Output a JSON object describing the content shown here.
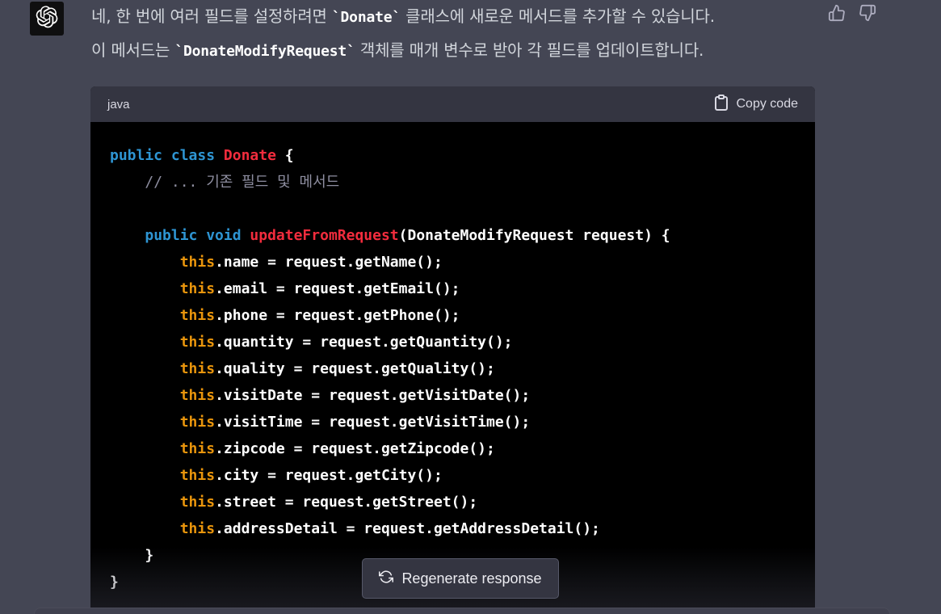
{
  "assistant": {
    "avatar_icon": "openai-logo-icon"
  },
  "message": {
    "line1_before": "네, 한 번에 여러 필드를 설정하려면 ",
    "line1_code": "`Donate`",
    "line1_after": " 클래스에 새로운 메서드를 추가할 수 있습니다.",
    "line2_before": "이 메서드는 ",
    "line2_code": "`DonateModifyRequest`",
    "line2_after": " 객체를 매개 변수로 받아 각 필드를 업데이트합니다."
  },
  "feedback": {
    "thumbs_up_icon": "thumbs-up-icon",
    "thumbs_down_icon": "thumbs-down-icon"
  },
  "code_block": {
    "language": "java",
    "copy_label": "Copy code",
    "copy_icon": "clipboard-icon",
    "lines": {
      "l1": {
        "kw": "public class ",
        "cls": "Donate",
        "rest": " {"
      },
      "l2": {
        "indent": "    ",
        "comment": "// ... 기존 필드 및 메서드"
      },
      "l4": {
        "indent": "    ",
        "kw": "public void ",
        "fn": "updateFromRequest",
        "rest": "(DonateModifyRequest request) {"
      },
      "fields": [
        {
          "this": "this",
          "rest": ".name = request.getName();"
        },
        {
          "this": "this",
          "rest": ".email = request.getEmail();"
        },
        {
          "this": "this",
          "rest": ".phone = request.getPhone();"
        },
        {
          "this": "this",
          "rest": ".quantity = request.getQuantity();"
        },
        {
          "this": "this",
          "rest": ".quality = request.getQuality();"
        },
        {
          "this": "this",
          "rest": ".visitDate = request.getVisitDate();"
        },
        {
          "this": "this",
          "rest": ".visitTime = request.getVisitTime();"
        },
        {
          "this": "this",
          "rest": ".zipcode = request.getZipcode();"
        },
        {
          "this": "this",
          "rest": ".city = request.getCity();"
        },
        {
          "this": "this",
          "rest": ".street = request.getStreet();"
        },
        {
          "this": "this",
          "rest": ".addressDetail = request.getAddressDetail();"
        }
      ],
      "close_method": "    }",
      "close_class": "}"
    }
  },
  "regenerate": {
    "label": "Regenerate response",
    "icon": "refresh-icon"
  },
  "colors": {
    "background": "#444654",
    "code_bg": "#000000",
    "header_bg": "#343541",
    "keyword": "#2e95d3",
    "class_name": "#f22c3d",
    "this_keyword": "#e9950c",
    "comment": "#8e8ea0"
  }
}
